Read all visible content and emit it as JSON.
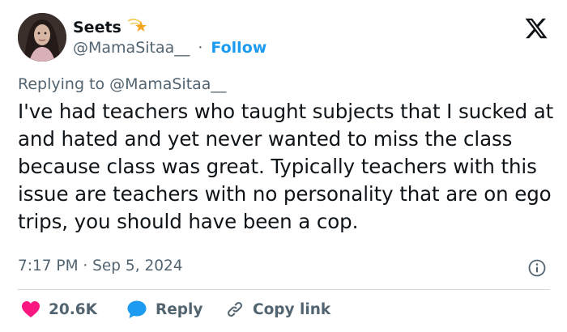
{
  "author": {
    "name": "Seets",
    "handle": "@MamaSitaa__",
    "separator": "·",
    "follow_label": "Follow"
  },
  "replying_to": {
    "prefix": "Replying to",
    "mention": "@MamaSitaa__"
  },
  "tweet": {
    "text": "I've had teachers who taught subjects that I sucked at and hated and yet never wanted to miss the class because class was great. Typically teachers with this issue are teachers with no personality that are on ego trips, you should have been a cop.",
    "timestamp": "7:17 PM · Sep 5, 2024"
  },
  "actions": {
    "likes": "20.6K",
    "reply_label": "Reply",
    "copy_link_label": "Copy link"
  },
  "colors": {
    "text": "#0f1419",
    "muted": "#536471",
    "link": "#1d9bf0",
    "like": "#f91880",
    "divider": "#cfd9de"
  },
  "icons": {
    "name_badge": "shooting-star-icon",
    "brand": "x-logo-icon",
    "info": "info-icon",
    "like": "heart-icon",
    "reply": "speech-bubble-icon",
    "copy": "link-icon"
  }
}
